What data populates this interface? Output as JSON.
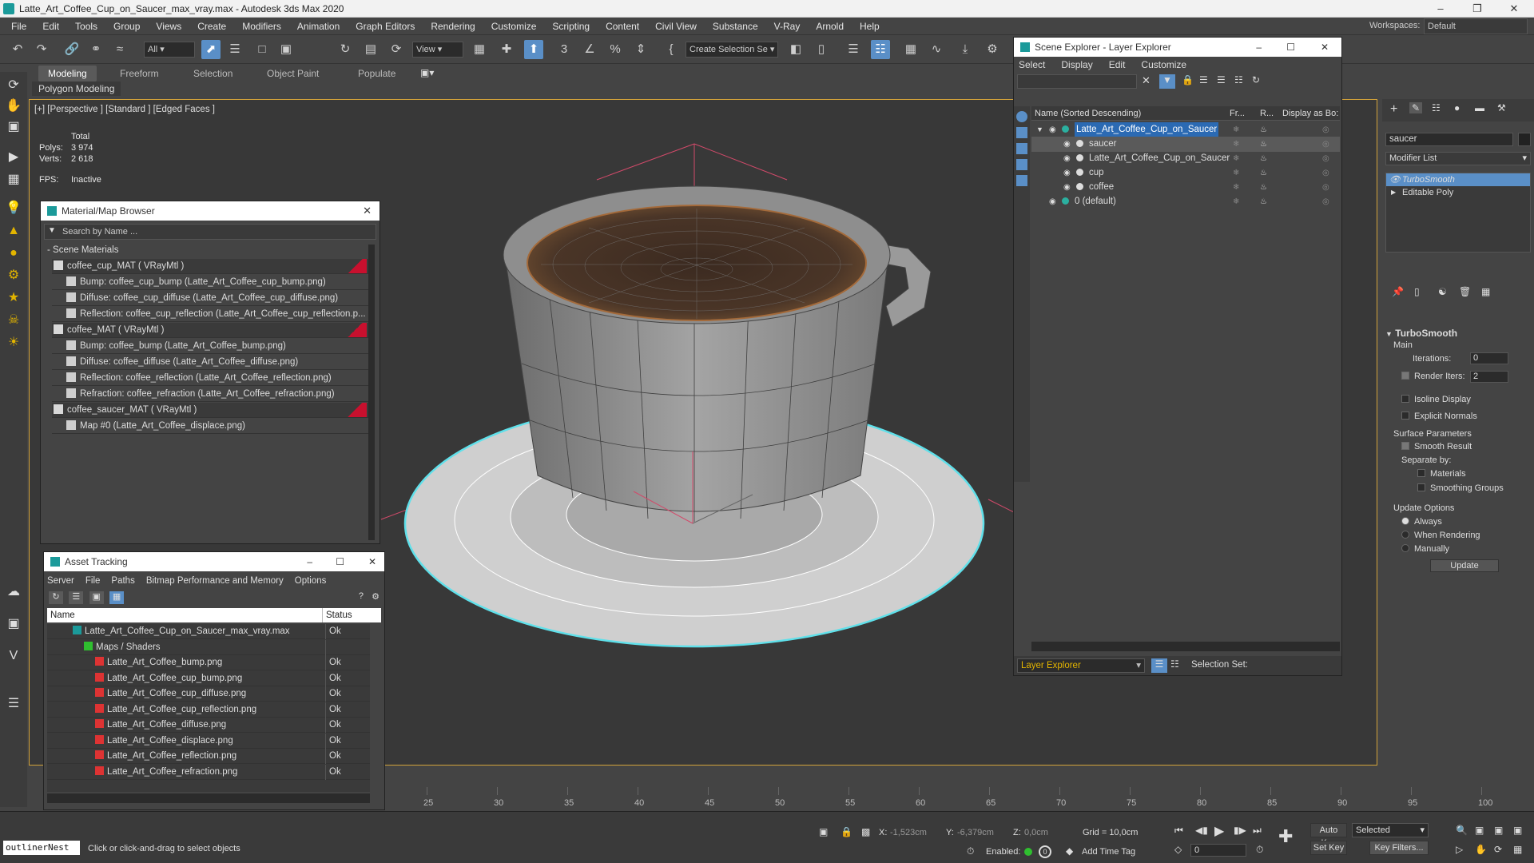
{
  "titlebar": {
    "title": "Latte_Art_Coffee_Cup_on_Saucer_max_vray.max - Autodesk 3ds Max 2020"
  },
  "menus": [
    "File",
    "Edit",
    "Tools",
    "Group",
    "Views",
    "Create",
    "Modifiers",
    "Animation",
    "Graph Editors",
    "Rendering",
    "Customize",
    "Scripting",
    "Content",
    "Civil View",
    "Substance",
    "V-Ray",
    "Arnold",
    "Help"
  ],
  "workspace": {
    "label": "Workspaces:",
    "value": "Default"
  },
  "toolbar": {
    "filter": "All",
    "view": "View",
    "selection_set": "Create Selection Se"
  },
  "ribbon": {
    "tabs": [
      "Modeling",
      "Freeform",
      "Selection",
      "Object Paint",
      "Populate"
    ],
    "subtab": "Polygon Modeling"
  },
  "viewport": {
    "label": "[+] [Perspective ] [Standard ] [Edged Faces ]",
    "stats": {
      "total": "Total",
      "polys_label": "Polys:",
      "polys": "3 974",
      "verts_label": "Verts:",
      "verts": "2 618",
      "fps_label": "FPS:",
      "fps": "Inactive"
    }
  },
  "material_browser": {
    "title": "Material/Map Browser",
    "search": "Search by Name ...",
    "group": "- Scene Materials",
    "rows": [
      {
        "text": "coffee_cup_MAT  ( VRayMtl )",
        "level": 0,
        "mat": true
      },
      {
        "text": "Bump: coffee_cup_bump (Latte_Art_Coffee_cup_bump.png)",
        "level": 1
      },
      {
        "text": "Diffuse: coffee_cup_diffuse (Latte_Art_Coffee_cup_diffuse.png)",
        "level": 1
      },
      {
        "text": "Reflection: coffee_cup_reflection (Latte_Art_Coffee_cup_reflection.p...",
        "level": 1
      },
      {
        "text": "coffee_MAT  ( VRayMtl )",
        "level": 0,
        "mat": true
      },
      {
        "text": "Bump: coffee_bump (Latte_Art_Coffee_bump.png)",
        "level": 1
      },
      {
        "text": "Diffuse: coffee_diffuse (Latte_Art_Coffee_diffuse.png)",
        "level": 1
      },
      {
        "text": "Reflection: coffee_reflection (Latte_Art_Coffee_reflection.png)",
        "level": 1
      },
      {
        "text": "Refraction: coffee_refraction (Latte_Art_Coffee_refraction.png)",
        "level": 1
      },
      {
        "text": "coffee_saucer_MAT  ( VRayMtl )",
        "level": 0,
        "mat": true
      },
      {
        "text": "Map #0 (Latte_Art_Coffee_displace.png)",
        "level": 1
      }
    ]
  },
  "asset_tracking": {
    "title": "Asset Tracking",
    "menus": [
      "Server",
      "File",
      "Paths",
      "Bitmap Performance and Memory",
      "Options"
    ],
    "cols": [
      "Name",
      "Status"
    ],
    "rows": [
      {
        "name": "Latte_Art_Coffee_Cup_on_Saucer_max_vray.max",
        "status": "Ok",
        "level": 0
      },
      {
        "name": "Maps / Shaders",
        "status": "",
        "level": 1
      },
      {
        "name": "Latte_Art_Coffee_bump.png",
        "status": "Ok",
        "level": 2
      },
      {
        "name": "Latte_Art_Coffee_cup_bump.png",
        "status": "Ok",
        "level": 2
      },
      {
        "name": "Latte_Art_Coffee_cup_diffuse.png",
        "status": "Ok",
        "level": 2
      },
      {
        "name": "Latte_Art_Coffee_cup_reflection.png",
        "status": "Ok",
        "level": 2
      },
      {
        "name": "Latte_Art_Coffee_diffuse.png",
        "status": "Ok",
        "level": 2
      },
      {
        "name": "Latte_Art_Coffee_displace.png",
        "status": "Ok",
        "level": 2
      },
      {
        "name": "Latte_Art_Coffee_reflection.png",
        "status": "Ok",
        "level": 2
      },
      {
        "name": "Latte_Art_Coffee_refraction.png",
        "status": "Ok",
        "level": 2
      }
    ]
  },
  "scene_explorer": {
    "title": "Scene Explorer - Layer Explorer",
    "menus": [
      "Select",
      "Display",
      "Edit",
      "Customize"
    ],
    "cols": [
      "Name (Sorted Descending)",
      "Fr...",
      "R...",
      "Display as Bo:"
    ],
    "rows": [
      {
        "name": "Latte_Art_Coffee_Cup_on_Saucer",
        "level": 0,
        "layer": true,
        "sel": false
      },
      {
        "name": "saucer",
        "level": 1,
        "sel": true
      },
      {
        "name": "Latte_Art_Coffee_Cup_on_Saucer",
        "level": 1,
        "sel": false
      },
      {
        "name": "cup",
        "level": 1,
        "sel": false
      },
      {
        "name": "coffee",
        "level": 1,
        "sel": false
      },
      {
        "name": "0 (default)",
        "level": 0,
        "layer": true,
        "sel": false
      }
    ],
    "footer_combo": "Layer Explorer",
    "footer_sel": "Selection Set:"
  },
  "command_panel": {
    "object_name": "saucer",
    "modifier_list": "Modifier List",
    "stack": [
      "TurboSmooth",
      "Editable Poly"
    ],
    "rollout": "TurboSmooth",
    "main": "Main",
    "iterations_label": "Iterations:",
    "iterations": "0",
    "render_iters_label": "Render Iters:",
    "render_iters": "2",
    "isoline": "Isoline Display",
    "explicit": "Explicit Normals",
    "surface": "Surface Parameters",
    "smooth": "Smooth Result",
    "separate": "Separate by:",
    "materials": "Materials",
    "smoothing": "Smoothing Groups",
    "update_opts": "Update Options",
    "always": "Always",
    "when_rendering": "When Rendering",
    "manually": "Manually",
    "update_btn": "Update"
  },
  "timeline": {
    "ticks": [
      "25",
      "30",
      "35",
      "40",
      "45",
      "50",
      "55",
      "60",
      "65",
      "70",
      "75",
      "80",
      "85",
      "90",
      "95",
      "100"
    ]
  },
  "statusbar": {
    "script": "outlinerNest",
    "prompt": "Click or click-and-drag to select objects",
    "x_label": "X:",
    "x": "-1,523cm",
    "y_label": "Y:",
    "y": "-6,379cm",
    "z_label": "Z:",
    "z": "0,0cm",
    "grid": "Grid = 10,0cm",
    "enabled": "Enabled:",
    "add_time_tag": "Add Time Tag",
    "auto_key": "Auto Key",
    "set_key": "Set Key",
    "selected": "Selected",
    "key_filters": "Key Filters...",
    "frame": "0",
    "frame_field": "0"
  },
  "colors": {
    "accent": "#5a8fc7",
    "selection_cyan": "#5fe0ea",
    "viewport_border": "#d2a23a",
    "red_swatch": "#c8102e"
  }
}
